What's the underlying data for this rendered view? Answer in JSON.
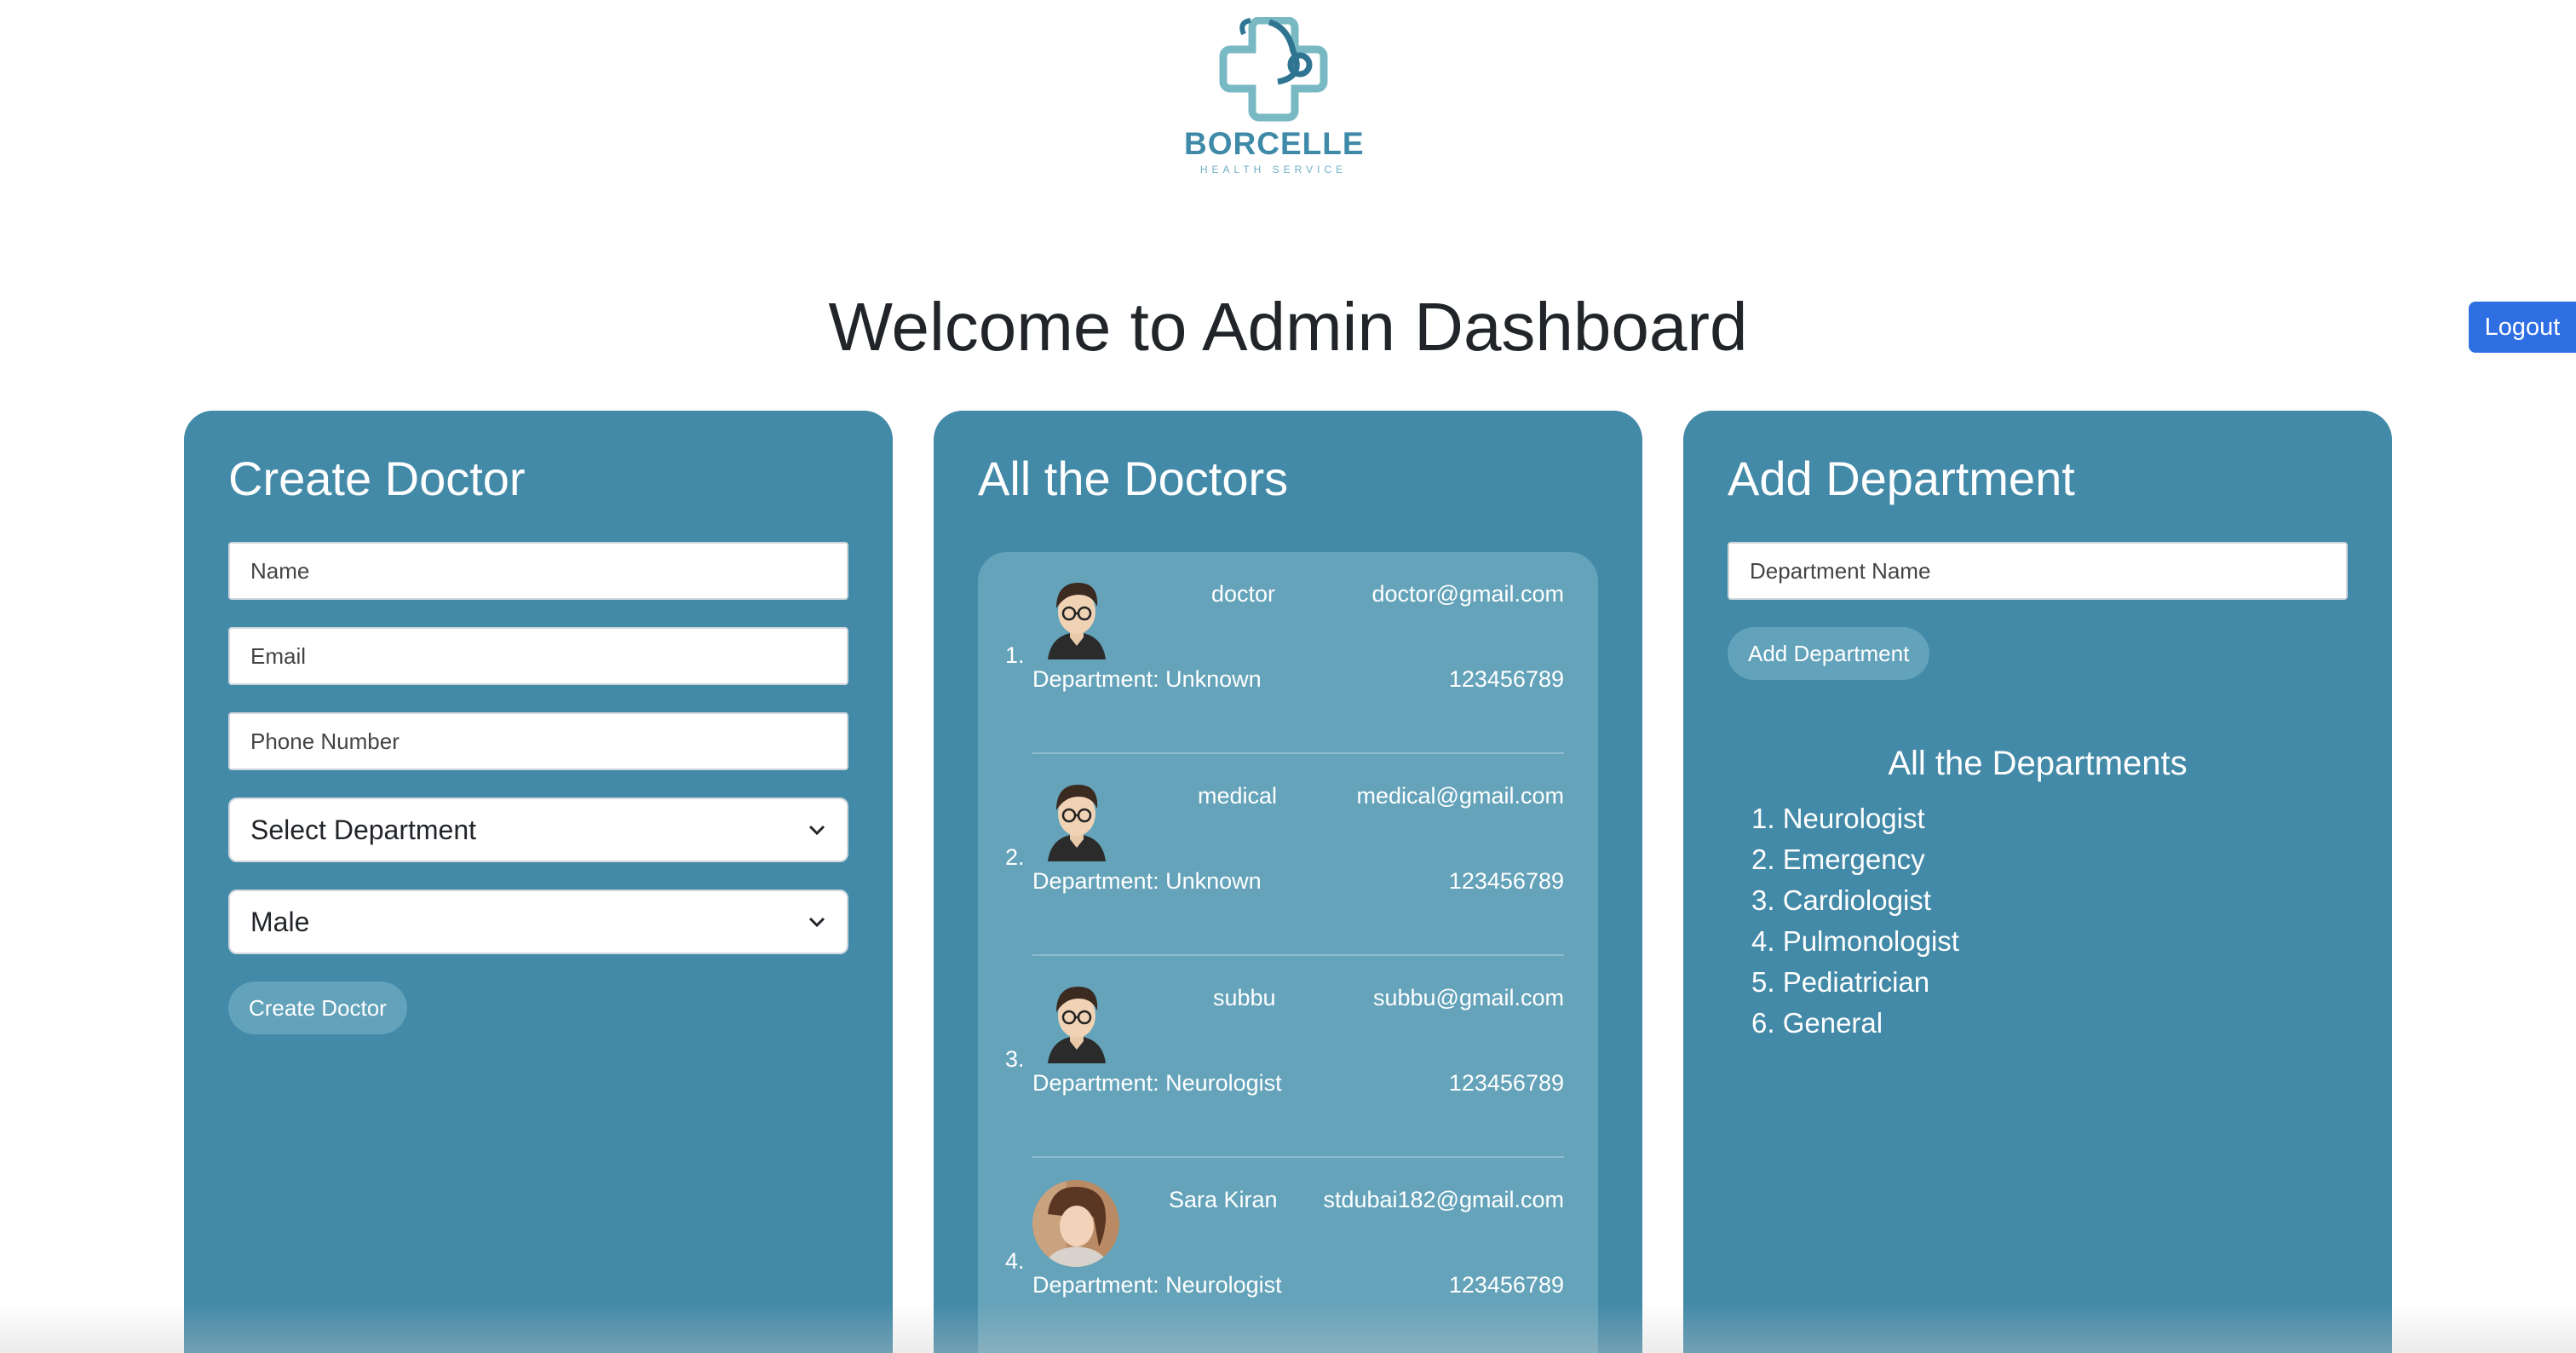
{
  "brand": {
    "name": "BORCELLE",
    "tagline": "HEALTH SERVICE"
  },
  "header": {
    "title": "Welcome to Admin Dashboard",
    "logout_label": "Logout"
  },
  "create_doctor": {
    "title": "Create Doctor",
    "name_placeholder": "Name",
    "email_placeholder": "Email",
    "phone_placeholder": "Phone Number",
    "department_select": "Select Department",
    "gender_select": "Male",
    "submit_label": "Create Doctor"
  },
  "doctors": {
    "title": "All the Doctors",
    "items": [
      {
        "num": "1.",
        "name": "doctor",
        "email": "doctor@gmail.com",
        "department": "Department: Unknown",
        "phone": "123456789",
        "avatar": "cartoon-avatar"
      },
      {
        "num": "2.",
        "name": "medical",
        "email": "medical@gmail.com",
        "department": "Department: Unknown",
        "phone": "123456789",
        "avatar": "cartoon-avatar"
      },
      {
        "num": "3.",
        "name": "subbu",
        "email": "subbu@gmail.com",
        "department": "Department: Neurologist",
        "phone": "123456789",
        "avatar": "cartoon-avatar"
      },
      {
        "num": "4.",
        "name": "Sara Kiran",
        "email": "stdubai182@gmail.com",
        "department": "Department: Neurologist",
        "phone": "123456789",
        "avatar": "photo"
      }
    ]
  },
  "add_department": {
    "title": "Add Department",
    "input_placeholder": "Department Name",
    "submit_label": "Add Department",
    "list_title": "All the Departments",
    "departments": [
      "1. Neurologist",
      "2. Emergency",
      "3. Cardiologist",
      "4. Pulmonologist",
      "5. Pediatrician",
      "6. General"
    ]
  },
  "colors": {
    "panel": "#438aa8",
    "list_bg": "#64a3ba",
    "logout": "#2f6fe4",
    "brand": "#3f8aa8"
  }
}
